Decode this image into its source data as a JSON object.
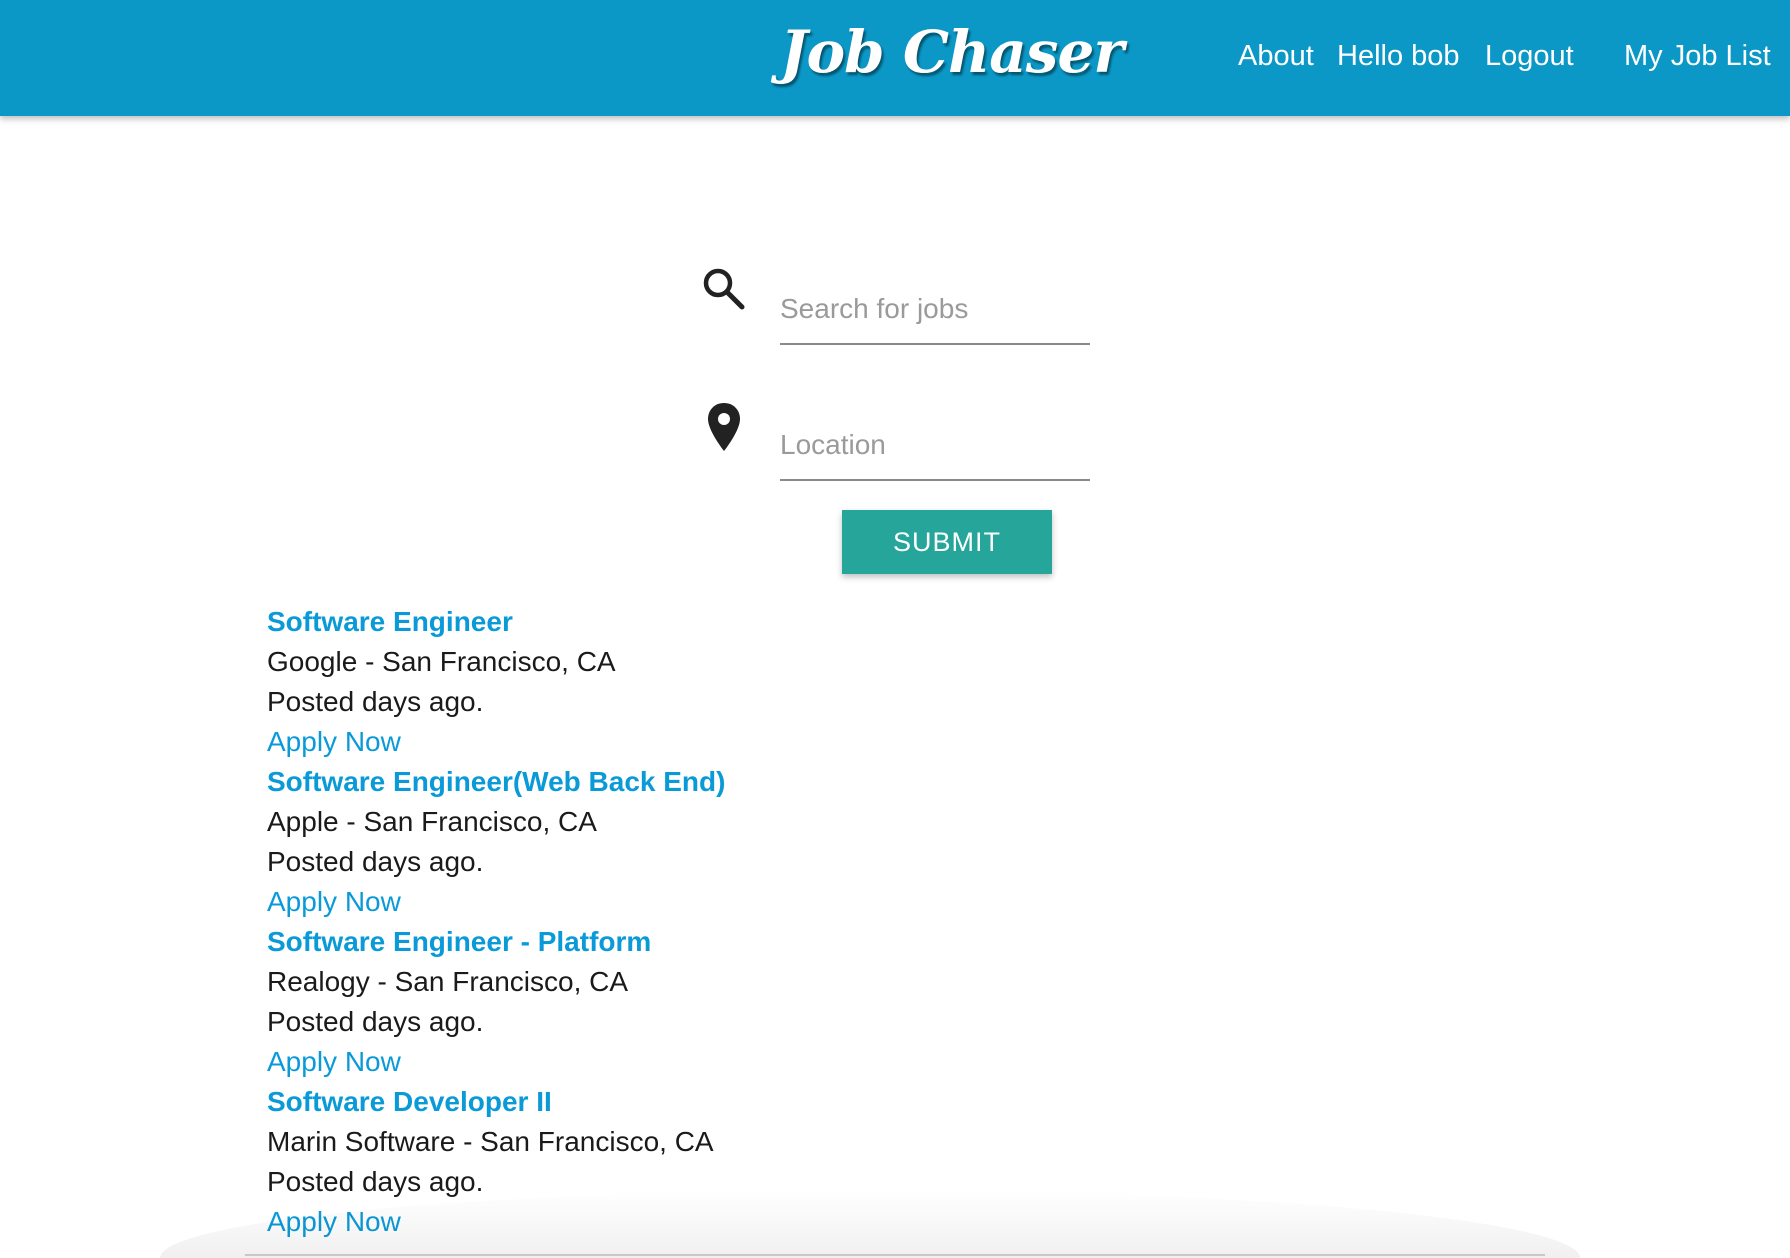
{
  "nav": {
    "brand": "Job Chaser",
    "about": "About",
    "hello": "Hello bob",
    "logout": "Logout",
    "job_list": "My Job List"
  },
  "search": {
    "keyword_placeholder": "Search for jobs",
    "location_placeholder": "Location",
    "submit_label": "SUBMIT"
  },
  "jobs": [
    {
      "title": "Software Engineer",
      "company_location": "Google - San Francisco, CA",
      "posted": "Posted days ago.",
      "apply": "Apply Now"
    },
    {
      "title": "Software Engineer(Web Back End)",
      "company_location": "Apple - San Francisco, CA",
      "posted": "Posted days ago.",
      "apply": "Apply Now"
    },
    {
      "title": "Software Engineer - Platform",
      "company_location": "Realogy - San Francisco, CA",
      "posted": "Posted days ago.",
      "apply": "Apply Now"
    },
    {
      "title": "Software Developer II",
      "company_location": "Marin Software - San Francisco, CA",
      "posted": "Posted days ago.",
      "apply": "Apply Now"
    }
  ],
  "colors": {
    "navbar": "#0b98c6",
    "submit": "#26a69a",
    "link": "#0a9ad8"
  },
  "icons": {
    "search": "search-icon",
    "location": "location-pin-icon"
  }
}
